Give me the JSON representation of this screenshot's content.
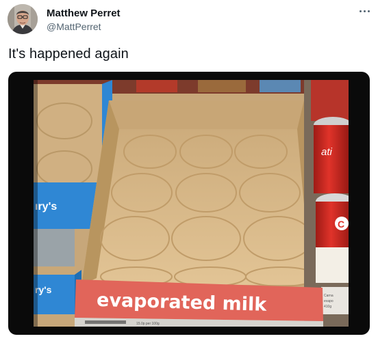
{
  "tweet": {
    "author_name": "Matthew Perret",
    "author_handle": "@MattPerret",
    "text": "It's happened again",
    "more_icon": "more-horizontal-icon"
  },
  "photo": {
    "box_label": "evaporated milk",
    "side_box_label_top": "ıry's",
    "side_box_label_bottom": "ry's",
    "price_tag_text": "15.0p per 100g",
    "can_tag_lines": [
      "Carna",
      "evapo",
      "410g"
    ],
    "colors": {
      "cardboard": "#d7b78a",
      "label_red": "#e1655a",
      "box_blue": "#2f87d4",
      "background": "#0a0a0a"
    }
  }
}
